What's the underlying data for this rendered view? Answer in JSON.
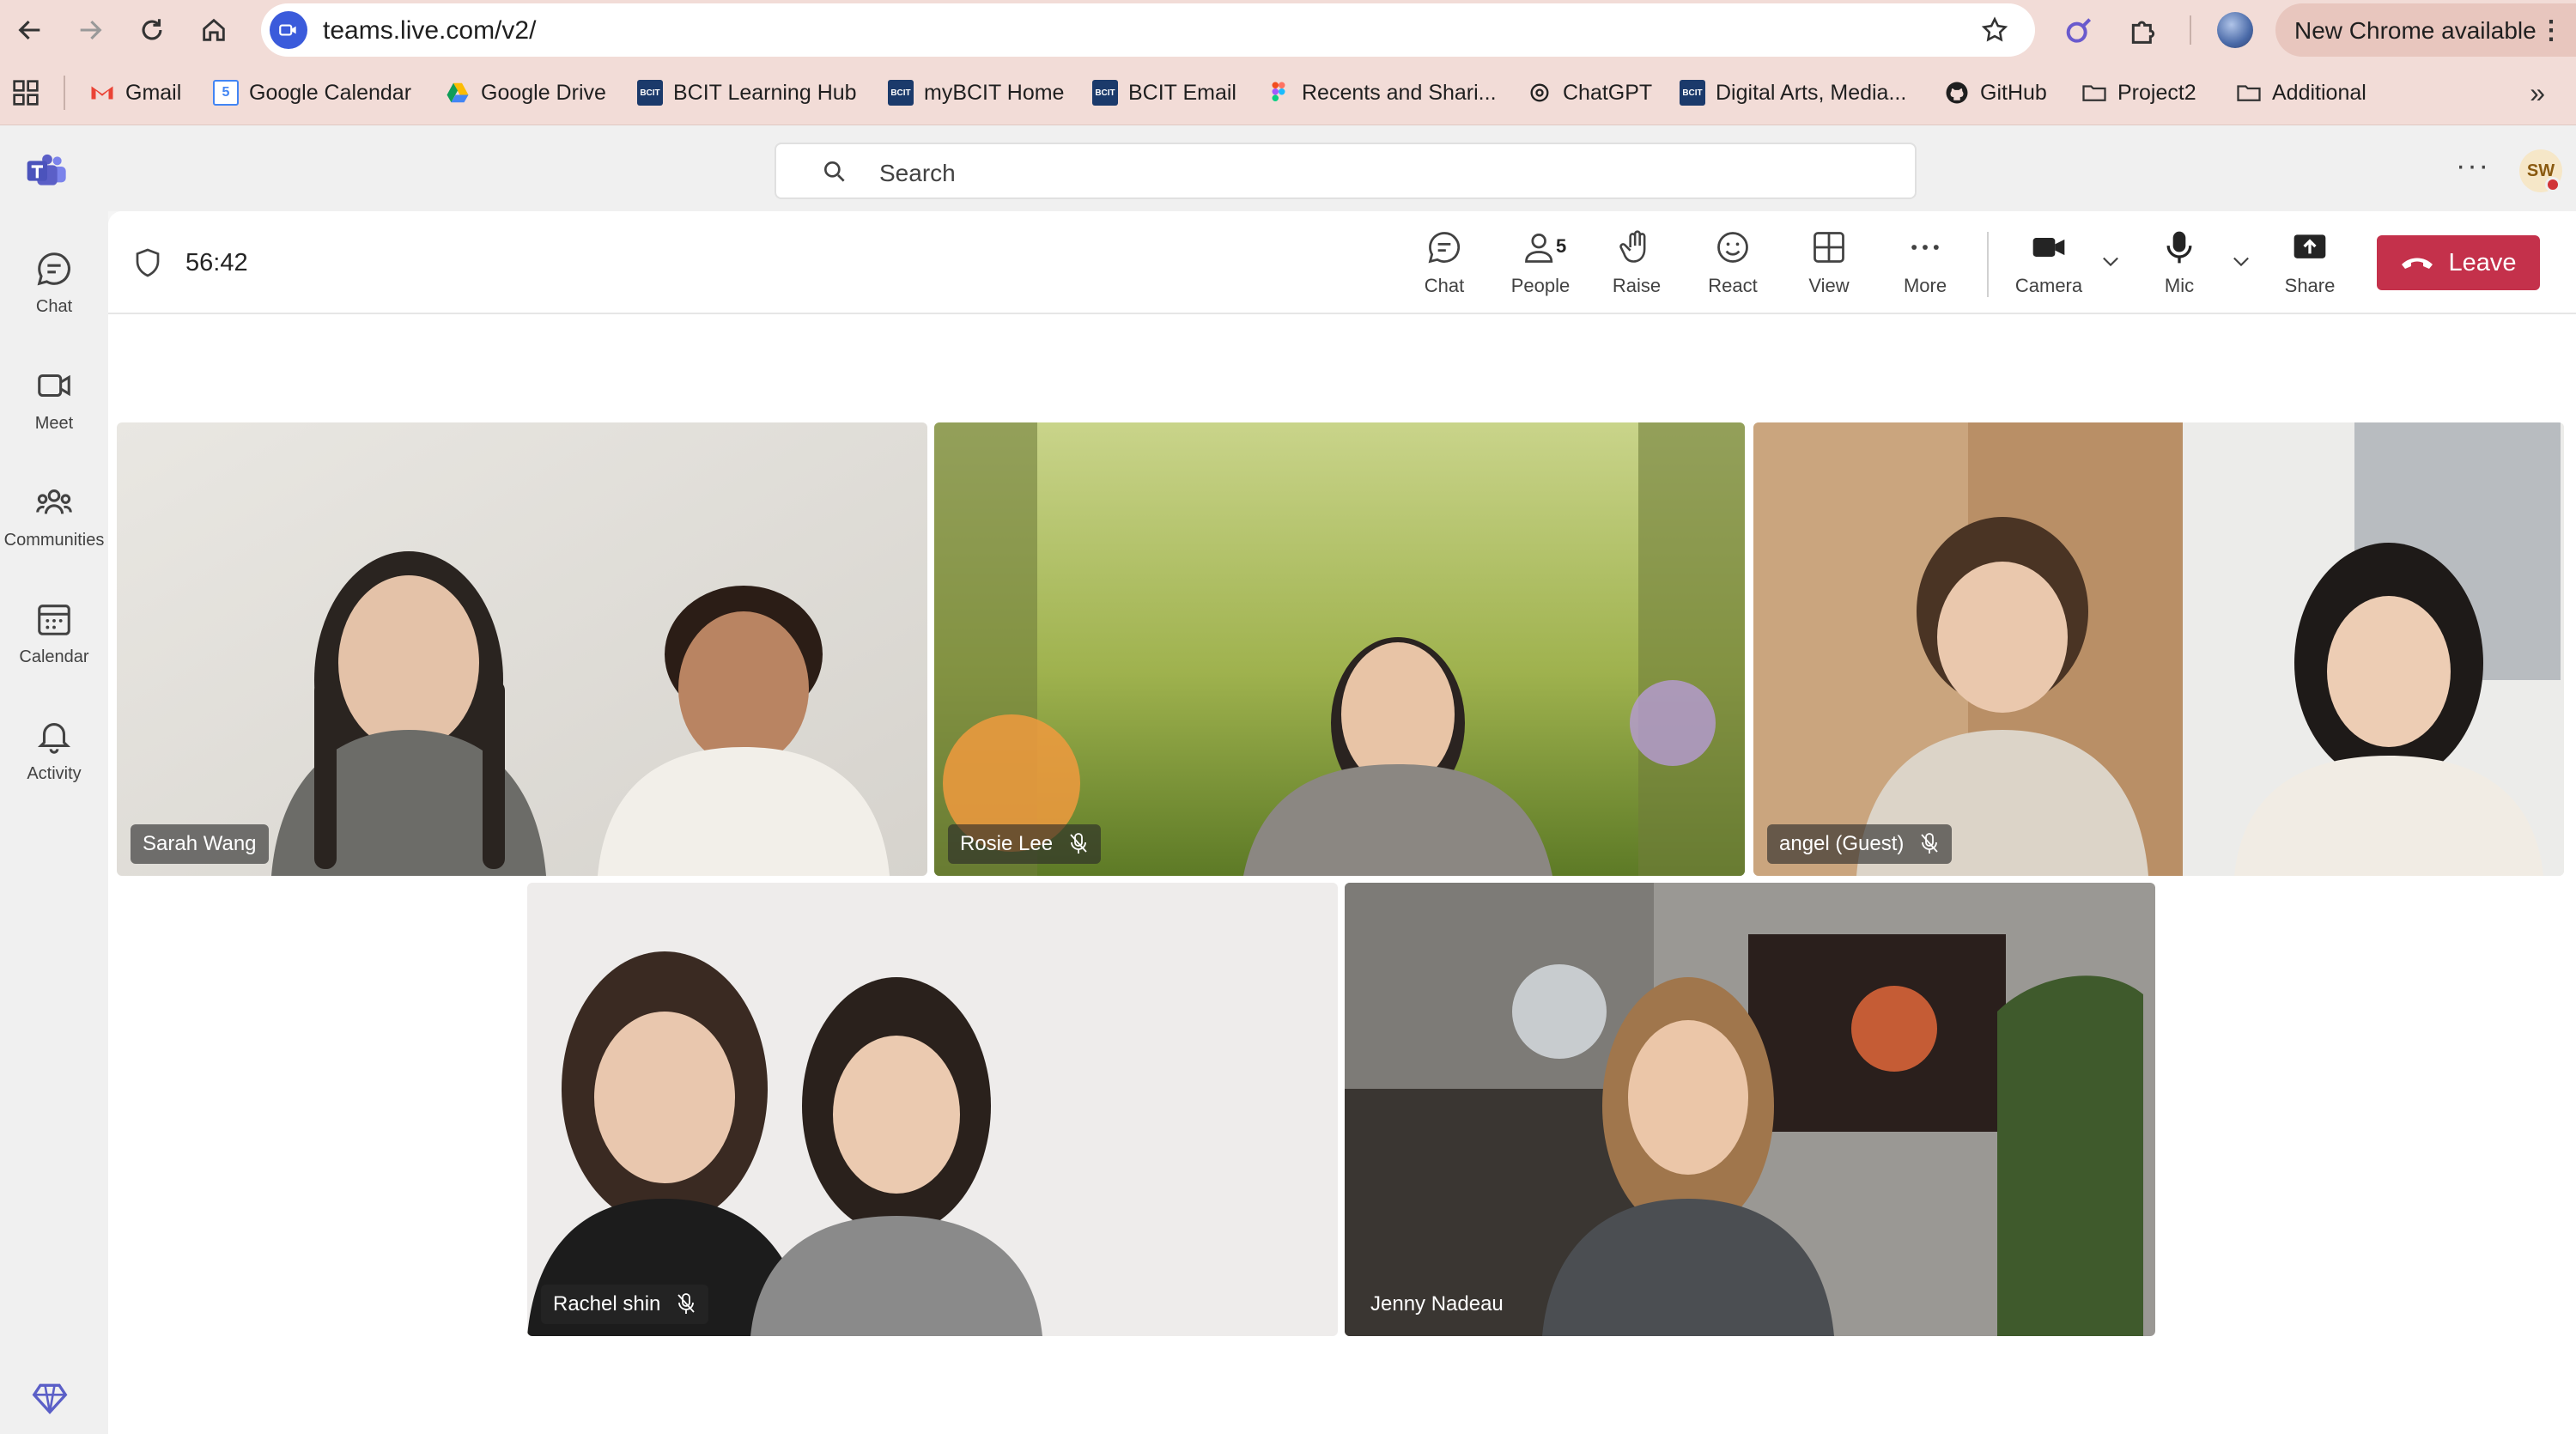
{
  "browser": {
    "url": "teams.live.com/v2/",
    "update_label": "New Chrome available",
    "bookmarks": [
      {
        "label": "Gmail",
        "icon": "gmail-icon"
      },
      {
        "label": "Google Calendar",
        "icon": "calendar-icon"
      },
      {
        "label": "Google Drive",
        "icon": "drive-icon"
      },
      {
        "label": "BCIT Learning Hub",
        "icon": "bcit-icon"
      },
      {
        "label": "myBCIT Home",
        "icon": "bcit-icon"
      },
      {
        "label": "BCIT Email",
        "icon": "bcit-icon"
      },
      {
        "label": "Recents and Shari...",
        "icon": "figma-icon"
      },
      {
        "label": "ChatGPT",
        "icon": "chatgpt-icon"
      },
      {
        "label": "Digital Arts, Media...",
        "icon": "bcit-icon"
      },
      {
        "label": "GitHub",
        "icon": "github-icon"
      },
      {
        "label": "Project2",
        "icon": "folder-icon"
      },
      {
        "label": "Additional",
        "icon": "folder-icon"
      }
    ],
    "bcit_mark": "BCIT",
    "calendar_day": "5"
  },
  "teams": {
    "search_placeholder": "Search",
    "avatar_initials": "SW",
    "rail": [
      {
        "label": "Chat",
        "icon": "chat-icon"
      },
      {
        "label": "Meet",
        "icon": "video-icon"
      },
      {
        "label": "Communities",
        "icon": "communities-icon"
      },
      {
        "label": "Calendar",
        "icon": "calendar-icon"
      },
      {
        "label": "Activity",
        "icon": "bell-icon"
      }
    ]
  },
  "meeting": {
    "timer": "56:42",
    "people_count": "5",
    "toolbar": {
      "chat": "Chat",
      "people": "People",
      "raise": "Raise",
      "react": "React",
      "view": "View",
      "more": "More",
      "camera": "Camera",
      "mic": "Mic",
      "share": "Share",
      "leave": "Leave"
    },
    "participants": [
      {
        "name": "Sarah Wang",
        "muted": false
      },
      {
        "name": "Rosie Lee",
        "muted": true
      },
      {
        "name": "angel (Guest)",
        "muted": true
      },
      {
        "name": "Rachel shin",
        "muted": true
      },
      {
        "name": "Jenny Nadeau",
        "muted": false
      }
    ]
  },
  "colors": {
    "chrome_bar": "#f2dcd7",
    "teams_accent": "#5b5fc7",
    "leave_red": "#c4314b"
  }
}
